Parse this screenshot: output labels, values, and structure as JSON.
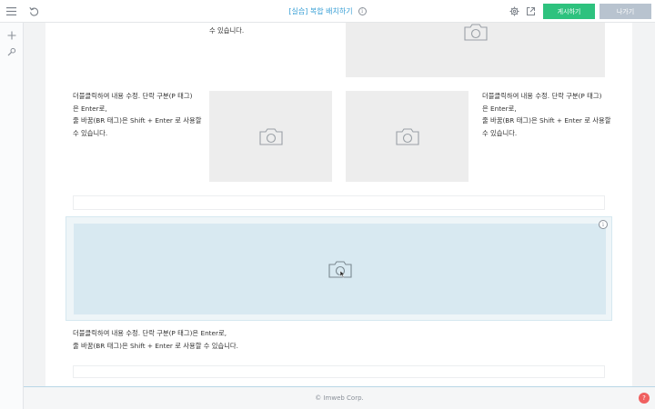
{
  "header": {
    "title": "[실습] 복합 배치하기",
    "publish_label": "게시하기",
    "exit_label": "나가기"
  },
  "icons": {
    "menu": "menu-icon",
    "undo": "undo-icon",
    "settings": "gear-icon",
    "open_external": "external-link-icon",
    "add": "plus-icon",
    "design": "brush-icon",
    "image": "camera-icon",
    "info": "info-icon"
  },
  "content": {
    "top_text_tail": "수 있습니다.",
    "para_left_lines": [
      "더블클릭하여 내용 수정. 단락 구분(P 태그)",
      "은 Enter로,",
      "줄 바꿈(BR 태그)은 Shift + Enter 로 사용할",
      "수 있습니다."
    ],
    "para_right_lines": [
      "더블클릭하여 내용 수정. 단락 구분(P 태그)",
      "은 Enter로,",
      "줄 바꿈(BR 태그)은 Shift + Enter 로 사용할",
      "수 있습니다."
    ],
    "para_bottom_lines": [
      "더블클릭하여 내용 수정. 단락 구분(P 태그)은 Enter로,",
      "줄 바꿈(BR 태그)은 Shift + Enter 로 사용할 수 있습니다."
    ]
  },
  "footer": {
    "copyright": "© Imweb Corp.",
    "help_label": "?"
  },
  "colors": {
    "accent_title": "#3aa0d6",
    "publish_button": "#2ec27e",
    "exit_button": "#b8c3cf",
    "selected_block": "#d8e9f1",
    "help_button": "#f06060"
  }
}
